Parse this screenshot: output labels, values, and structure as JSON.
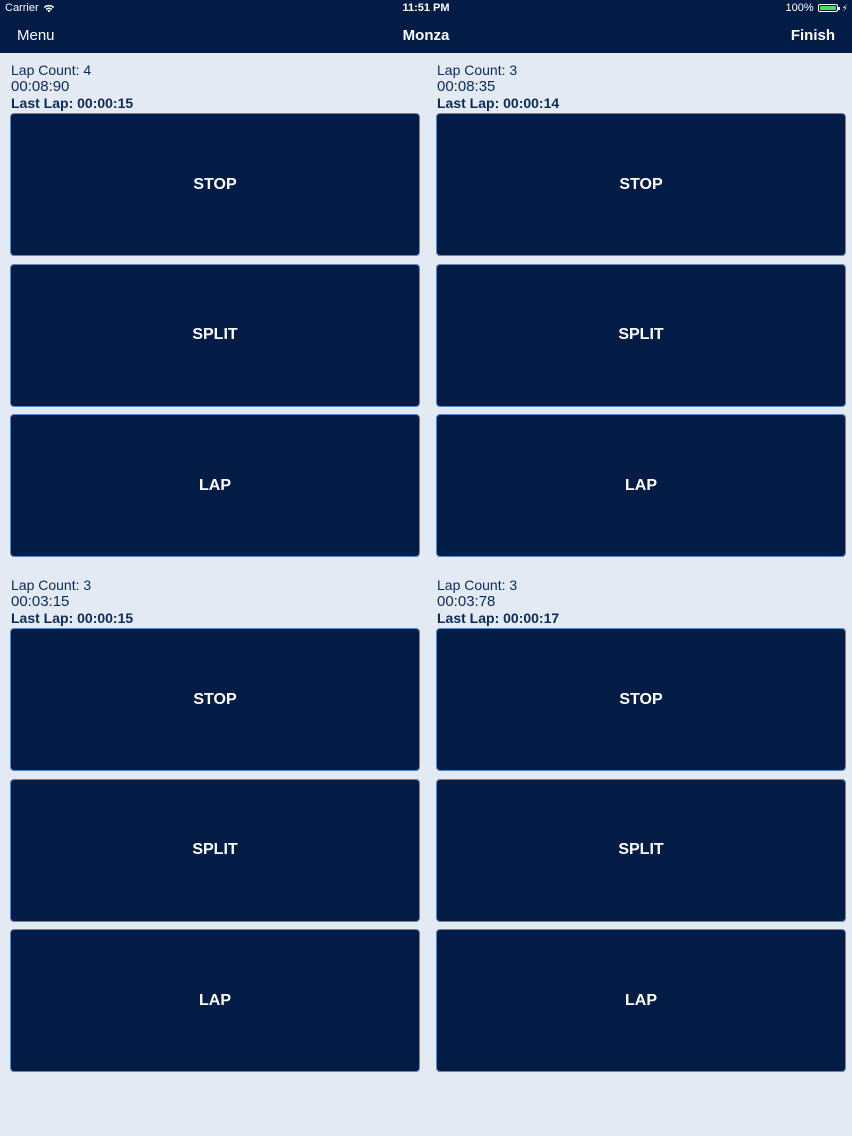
{
  "status_bar": {
    "carrier": "Carrier",
    "time": "11:51 PM",
    "battery": "100%"
  },
  "nav": {
    "left": "Menu",
    "title": "Monza",
    "right": "Finish"
  },
  "colors": {
    "bar": "#021c46",
    "button": "#021c46",
    "background": "#e3eaf3",
    "battery": "#4cd964"
  },
  "timers": [
    {
      "lap_count": "Lap Count: 4",
      "time": "00:08:90",
      "last_lap": "Last Lap: 00:00:15",
      "buttons": [
        "STOP",
        "SPLIT",
        "LAP"
      ]
    },
    {
      "lap_count": "Lap Count: 3",
      "time": "00:08:35",
      "last_lap": "Last Lap: 00:00:14",
      "buttons": [
        "STOP",
        "SPLIT",
        "LAP"
      ]
    },
    {
      "lap_count": "Lap Count: 3",
      "time": "00:03:15",
      "last_lap": "Last Lap: 00:00:15",
      "buttons": [
        "STOP",
        "SPLIT",
        "LAP"
      ]
    },
    {
      "lap_count": "Lap Count: 3",
      "time": "00:03:78",
      "last_lap": "Last Lap: 00:00:17",
      "buttons": [
        "STOP",
        "SPLIT",
        "LAP"
      ]
    }
  ]
}
